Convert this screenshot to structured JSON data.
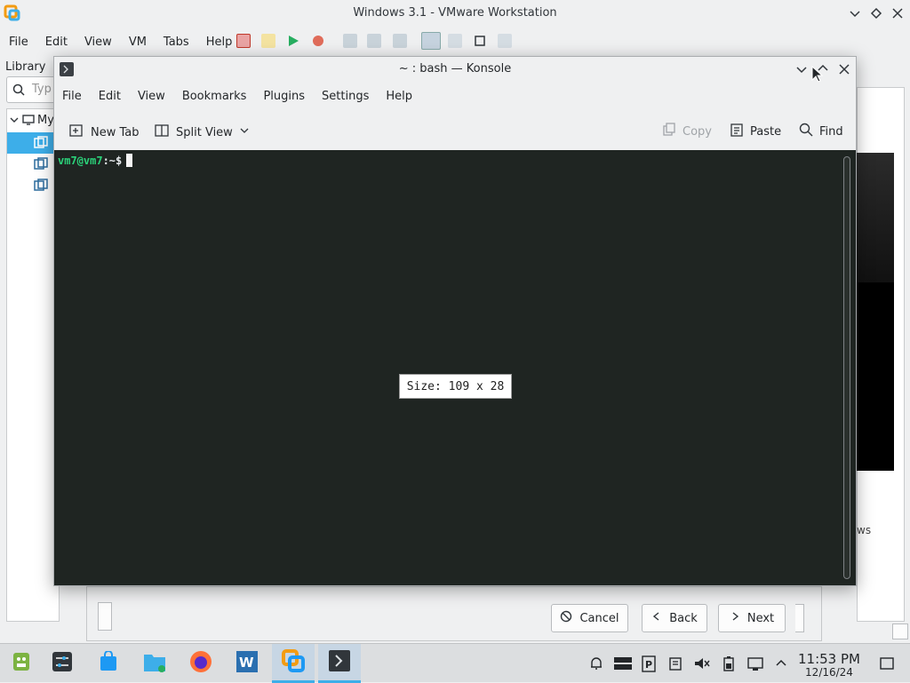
{
  "vmware": {
    "title": "Windows 3.1 - VMware Workstation",
    "menu": [
      "File",
      "Edit",
      "View",
      "VM",
      "Tabs",
      "Help"
    ],
    "library_label": "Library",
    "search_placeholder": "Typ",
    "tree": {
      "root_label": "My"
    },
    "right_pane_text": "ws",
    "wizard": {
      "cancel": "Cancel",
      "back": "Back",
      "next": "Next"
    },
    "accent_color": "#3daee9"
  },
  "konsole": {
    "title": "~ : bash — Konsole",
    "menu": [
      "File",
      "Edit",
      "View",
      "Bookmarks",
      "Plugins",
      "Settings",
      "Help"
    ],
    "toolbar": {
      "new_tab": "New Tab",
      "split_view": "Split View",
      "copy": "Copy",
      "paste": "Paste",
      "find": "Find"
    },
    "terminal": {
      "prompt_user": "vm7@vm7",
      "prompt_path": ":~$",
      "prompt_color": "#2bd37a",
      "background": "#1f2522"
    },
    "size_tooltip": "Size: 109 x 28"
  },
  "taskbar": {
    "apps": [
      "app-launcher",
      "system-settings",
      "discover-store",
      "dolphin-file-manager",
      "firefox",
      "libreoffice-writer",
      "vmware-workstation",
      "konsole"
    ],
    "clock_time": "11:53 PM",
    "clock_date": "12/16/24"
  }
}
